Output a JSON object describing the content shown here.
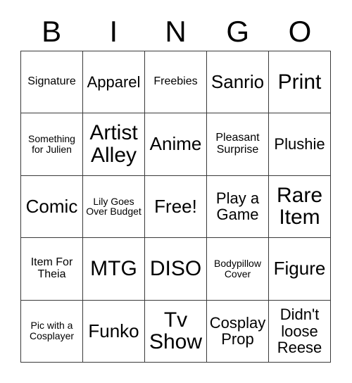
{
  "card": {
    "header_letters": [
      "B",
      "I",
      "N",
      "G",
      "O"
    ],
    "colors": {
      "background": "#ffffff",
      "text": "#000000",
      "grid_line": "#3a3a3a"
    },
    "rows": [
      [
        {
          "label": "Signature",
          "size": "fs-sm"
        },
        {
          "label": "Apparel",
          "size": "fs-md"
        },
        {
          "label": "Freebies",
          "size": "fs-sm"
        },
        {
          "label": "Sanrio",
          "size": "fs-lg"
        },
        {
          "label": "Print",
          "size": "fs-xl"
        }
      ],
      [
        {
          "label": "Something for Julien",
          "size": "fs-xs"
        },
        {
          "label": "Artist Alley",
          "size": "fs-xl"
        },
        {
          "label": "Anime",
          "size": "fs-lg"
        },
        {
          "label": "Pleasant Surprise",
          "size": "fs-sm"
        },
        {
          "label": "Plushie",
          "size": "fs-md"
        }
      ],
      [
        {
          "label": "Comic",
          "size": "fs-lg"
        },
        {
          "label": "Lily Goes Over Budget",
          "size": "fs-xs"
        },
        {
          "label": "Free!",
          "size": "fs-lg"
        },
        {
          "label": "Play a Game",
          "size": "fs-md"
        },
        {
          "label": "Rare Item",
          "size": "fs-xl"
        }
      ],
      [
        {
          "label": "Item For Theia",
          "size": "fs-sm"
        },
        {
          "label": "MTG",
          "size": "fs-xl"
        },
        {
          "label": "DISO",
          "size": "fs-xl"
        },
        {
          "label": "Bodypillow Cover",
          "size": "fs-xs"
        },
        {
          "label": "Figure",
          "size": "fs-lg"
        }
      ],
      [
        {
          "label": "Pic with a Cosplayer",
          "size": "fs-xs"
        },
        {
          "label": "Funko",
          "size": "fs-lg"
        },
        {
          "label": "Tv Show",
          "size": "fs-xl"
        },
        {
          "label": "Cosplay Prop",
          "size": "fs-md"
        },
        {
          "label": "Didn't loose Reese",
          "size": "fs-md"
        }
      ]
    ]
  }
}
